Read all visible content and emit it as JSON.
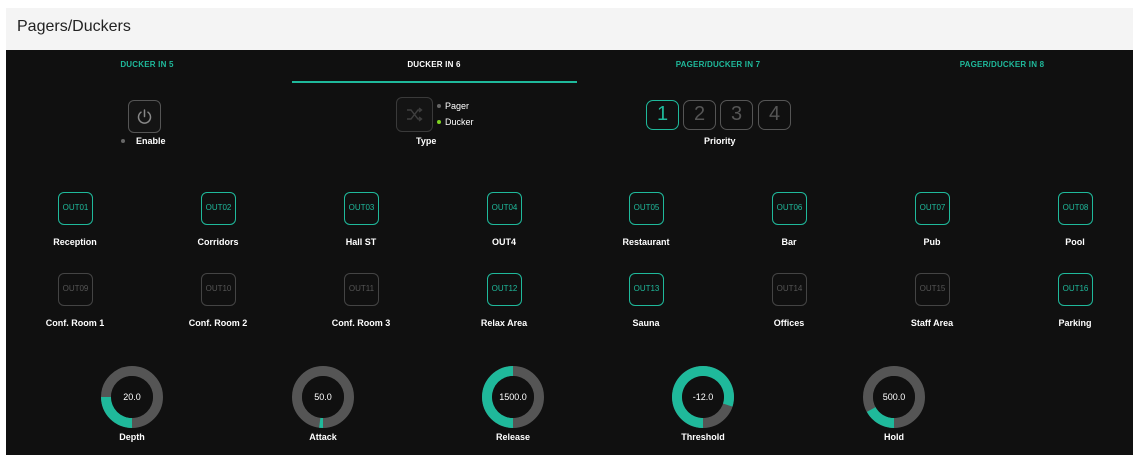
{
  "page_title": "Pagers/Duckers",
  "tabs": [
    {
      "label": "DUCKER IN 5"
    },
    {
      "label": "DUCKER IN 6"
    },
    {
      "label": "PAGER/DUCKER IN 7"
    },
    {
      "label": "PAGER/DUCKER IN 8"
    }
  ],
  "active_tab": "DUCKER IN 6",
  "enable": {
    "label": "Enable",
    "icon": "power-icon",
    "state": "off"
  },
  "type": {
    "label": "Type",
    "icon": "shuffle-icon",
    "options": [
      "Pager",
      "Ducker"
    ],
    "selected": "Ducker"
  },
  "priority": {
    "label": "Priority",
    "options": [
      "1",
      "2",
      "3",
      "4"
    ],
    "selected": "1"
  },
  "outputs": [
    {
      "code": "OUT01",
      "name": "Reception",
      "active": true
    },
    {
      "code": "OUT02",
      "name": "Corridors",
      "active": true
    },
    {
      "code": "OUT03",
      "name": "Hall ST",
      "active": true
    },
    {
      "code": "OUT04",
      "name": "OUT4",
      "active": true
    },
    {
      "code": "OUT05",
      "name": "Restaurant",
      "active": true
    },
    {
      "code": "OUT06",
      "name": "Bar",
      "active": true
    },
    {
      "code": "OUT07",
      "name": "Pub",
      "active": true
    },
    {
      "code": "OUT08",
      "name": "Pool",
      "active": true
    },
    {
      "code": "OUT09",
      "name": "Conf. Room 1",
      "active": false
    },
    {
      "code": "OUT10",
      "name": "Conf. Room 2",
      "active": false
    },
    {
      "code": "OUT11",
      "name": "Conf. Room 3",
      "active": false
    },
    {
      "code": "OUT12",
      "name": "Relax Area",
      "active": true
    },
    {
      "code": "OUT13",
      "name": "Sauna",
      "active": true
    },
    {
      "code": "OUT14",
      "name": "Offices",
      "active": false
    },
    {
      "code": "OUT15",
      "name": "Staff Area",
      "active": false
    },
    {
      "code": "OUT16",
      "name": "Parking",
      "active": true
    }
  ],
  "knobs": [
    {
      "label": "Depth",
      "value": "20.0",
      "level": 0.25
    },
    {
      "label": "Attack",
      "value": "50.0",
      "level": 0.02
    },
    {
      "label": "Release",
      "value": "1500.0",
      "level": 0.5
    },
    {
      "label": "Threshold",
      "value": "-12.0",
      "level": 0.8
    },
    {
      "label": "Hold",
      "value": "500.0",
      "level": 0.17
    }
  ],
  "colors": {
    "accent": "#1fb99b",
    "panel_bg": "#101010",
    "inactive": "#555555",
    "track": "#555555"
  }
}
